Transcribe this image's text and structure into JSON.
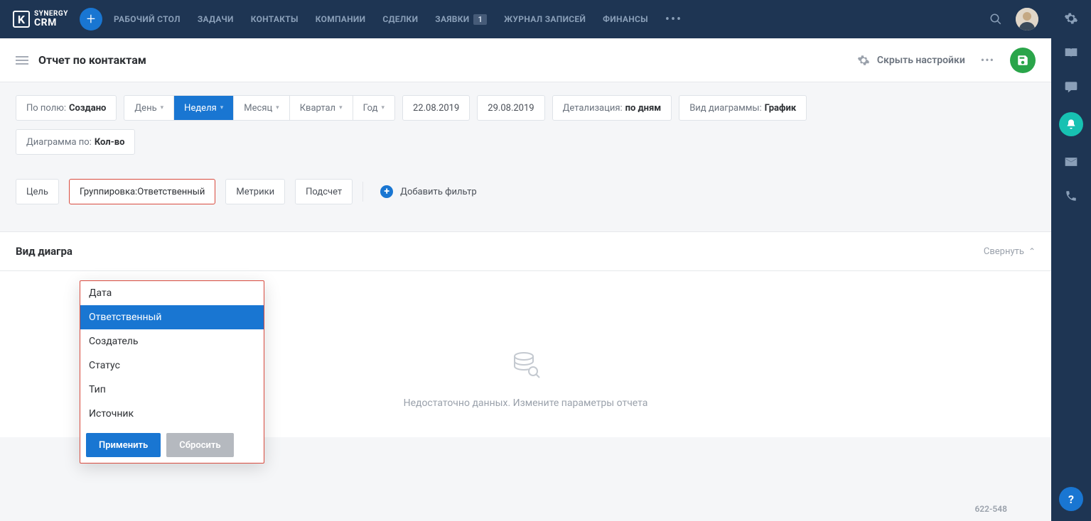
{
  "brand": {
    "line1": "SYNERGY",
    "line2": "CRM"
  },
  "nav": {
    "items": [
      "РАБОЧИЙ СТОЛ",
      "ЗАДАЧИ",
      "КОНТАКТЫ",
      "КОМПАНИИ",
      "СДЕЛКИ",
      "ЗАЯВКИ",
      "ЖУРНАЛ ЗАПИСЕЙ",
      "ФИНАНСЫ"
    ],
    "badge_requests": "1"
  },
  "header": {
    "title": "Отчет по контактам",
    "hide_settings": "Скрыть настройки"
  },
  "filters": {
    "field_label": "По полю:",
    "field_value": "Создано",
    "periods": [
      "День",
      "Неделя",
      "Месяц",
      "Квартал",
      "Год"
    ],
    "active_period_index": 1,
    "date_from": "22.08.2019",
    "date_to": "29.08.2019",
    "detail_label": "Детализация:",
    "detail_value": "по дням",
    "chart_type_label": "Вид диаграммы:",
    "chart_type_value": "График",
    "diagram_by_label": "Диаграмма по:",
    "diagram_by_value": "Кол-во"
  },
  "tabs": {
    "target": "Цель",
    "grouping_label": "Группировка:",
    "grouping_value": "Ответственный",
    "metrics": "Метрики",
    "count": "Подсчет",
    "add_filter": "Добавить фильтр"
  },
  "dropdown": {
    "options": [
      "Дата",
      "Ответственный",
      "Создатель",
      "Статус",
      "Тип",
      "Источник"
    ],
    "selected_index": 1,
    "apply": "Применить",
    "reset": "Сбросить"
  },
  "chart": {
    "section_title": "Вид диагра",
    "collapse": "Свернуть",
    "empty": "Недостаточно данных. Измените параметры отчета"
  },
  "footer": {
    "version": "622-548"
  }
}
